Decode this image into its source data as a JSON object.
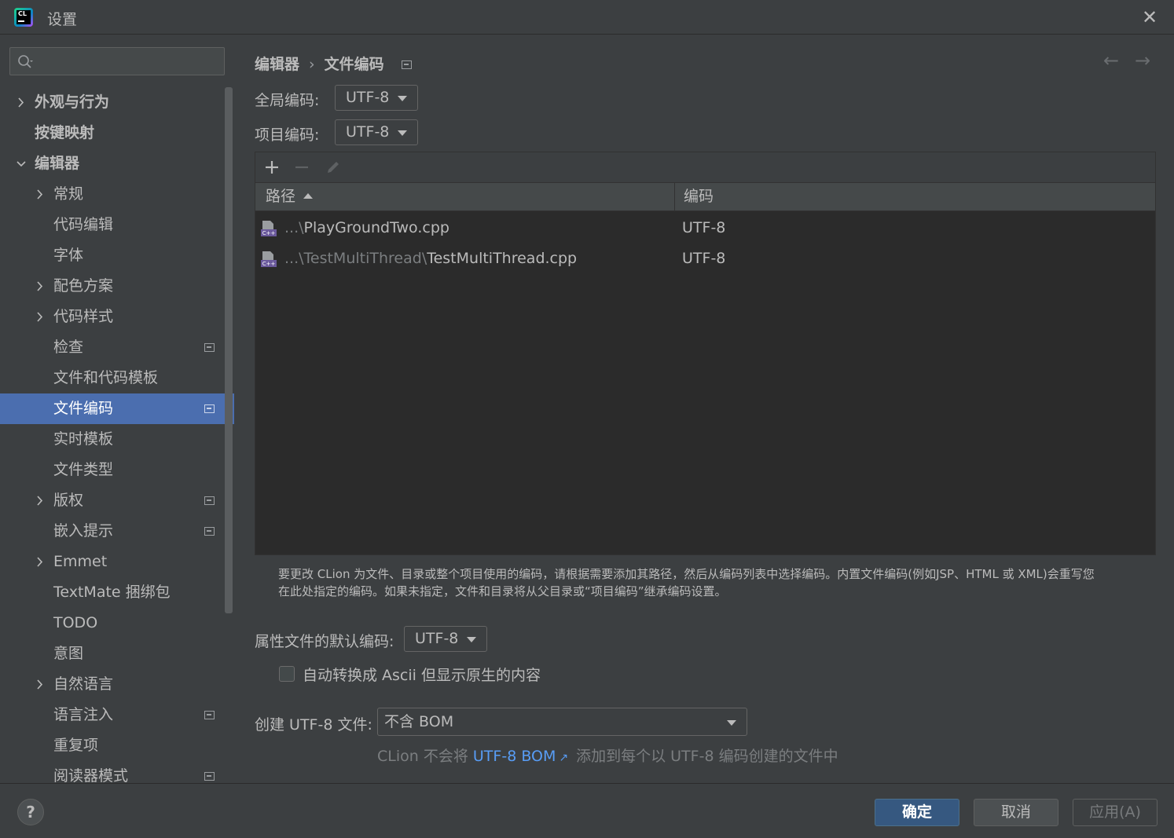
{
  "window": {
    "title": "设置",
    "app_icon": "clion-icon",
    "app_icon_text": "CL"
  },
  "sidebar": {
    "search": {
      "value": "",
      "placeholder": ""
    },
    "items": [
      {
        "label": "外观与行为",
        "expandable": true,
        "expanded": false,
        "bold": true
      },
      {
        "label": "按键映射",
        "expandable": false,
        "bold": true
      },
      {
        "label": "编辑器",
        "expandable": true,
        "expanded": true,
        "bold": true
      },
      {
        "label": "常规",
        "expandable": true,
        "expanded": false
      },
      {
        "label": "代码编辑"
      },
      {
        "label": "字体"
      },
      {
        "label": "配色方案",
        "expandable": true,
        "expanded": false
      },
      {
        "label": "代码样式",
        "expandable": true,
        "expanded": false
      },
      {
        "label": "检查",
        "project_badge": true
      },
      {
        "label": "文件和代码模板"
      },
      {
        "label": "文件编码",
        "selected": true,
        "project_badge": true
      },
      {
        "label": "实时模板"
      },
      {
        "label": "文件类型"
      },
      {
        "label": "版权",
        "expandable": true,
        "expanded": false,
        "project_badge": true
      },
      {
        "label": "嵌入提示",
        "project_badge": true
      },
      {
        "label": "Emmet",
        "expandable": true,
        "expanded": false
      },
      {
        "label": "TextMate 捆绑包"
      },
      {
        "label": "TODO"
      },
      {
        "label": "意图"
      },
      {
        "label": "自然语言",
        "expandable": true,
        "expanded": false
      },
      {
        "label": "语言注入",
        "project_badge": true
      },
      {
        "label": "重复项"
      },
      {
        "label": "阅读器模式",
        "project_badge": true
      }
    ]
  },
  "main": {
    "breadcrumb": {
      "parent": "编辑器",
      "separator": "›",
      "current": "文件编码"
    },
    "global_encoding": {
      "label": "全局编码:",
      "value": "UTF-8"
    },
    "project_encoding": {
      "label": "项目编码:",
      "value": "UTF-8"
    },
    "table": {
      "toolbar": [
        "add-icon",
        "remove-icon",
        "edit-icon"
      ],
      "columns": {
        "path": "路径",
        "encoding": "编码"
      },
      "sort": "path-ascending",
      "rows": [
        {
          "path_prefix": "...\\",
          "file": "PlayGroundTwo.cpp",
          "encoding": "UTF-8"
        },
        {
          "path_prefix": "...\\TestMultiThread\\",
          "file": "TestMultiThread.cpp",
          "encoding": "UTF-8"
        }
      ]
    },
    "info_line1": "要更改 CLion 为文件、目录或整个项目使用的编码，请根据需要添加其路径，然后从编码列表中选择编码。内置文件编码(例如JSP、HTML 或 XML)会重写您",
    "info_line2": "在此处指定的编码。如果未指定，文件和目录将从父目录或“项目编码”继承编码设置。",
    "properties_encoding": {
      "label": "属性文件的默认编码:",
      "value": "UTF-8"
    },
    "ascii_checkbox": {
      "label": "自动转换成 Ascii 但显示原生的内容",
      "checked": false
    },
    "create_utf8": {
      "label": "创建 UTF-8 文件:",
      "value": "不含 BOM"
    },
    "hint": {
      "prefix": "CLion 不会将",
      "link": "UTF-8 BOM",
      "suffix": "添加到每个以 UTF-8 编码创建的文件中"
    }
  },
  "footer": {
    "help": "?",
    "ok": "确定",
    "cancel": "取消",
    "apply": "应用(A)"
  },
  "colors": {
    "background": "#3c3f41",
    "selection": "#4b6eaf",
    "link": "#589df6",
    "ok_button": "#365880"
  }
}
